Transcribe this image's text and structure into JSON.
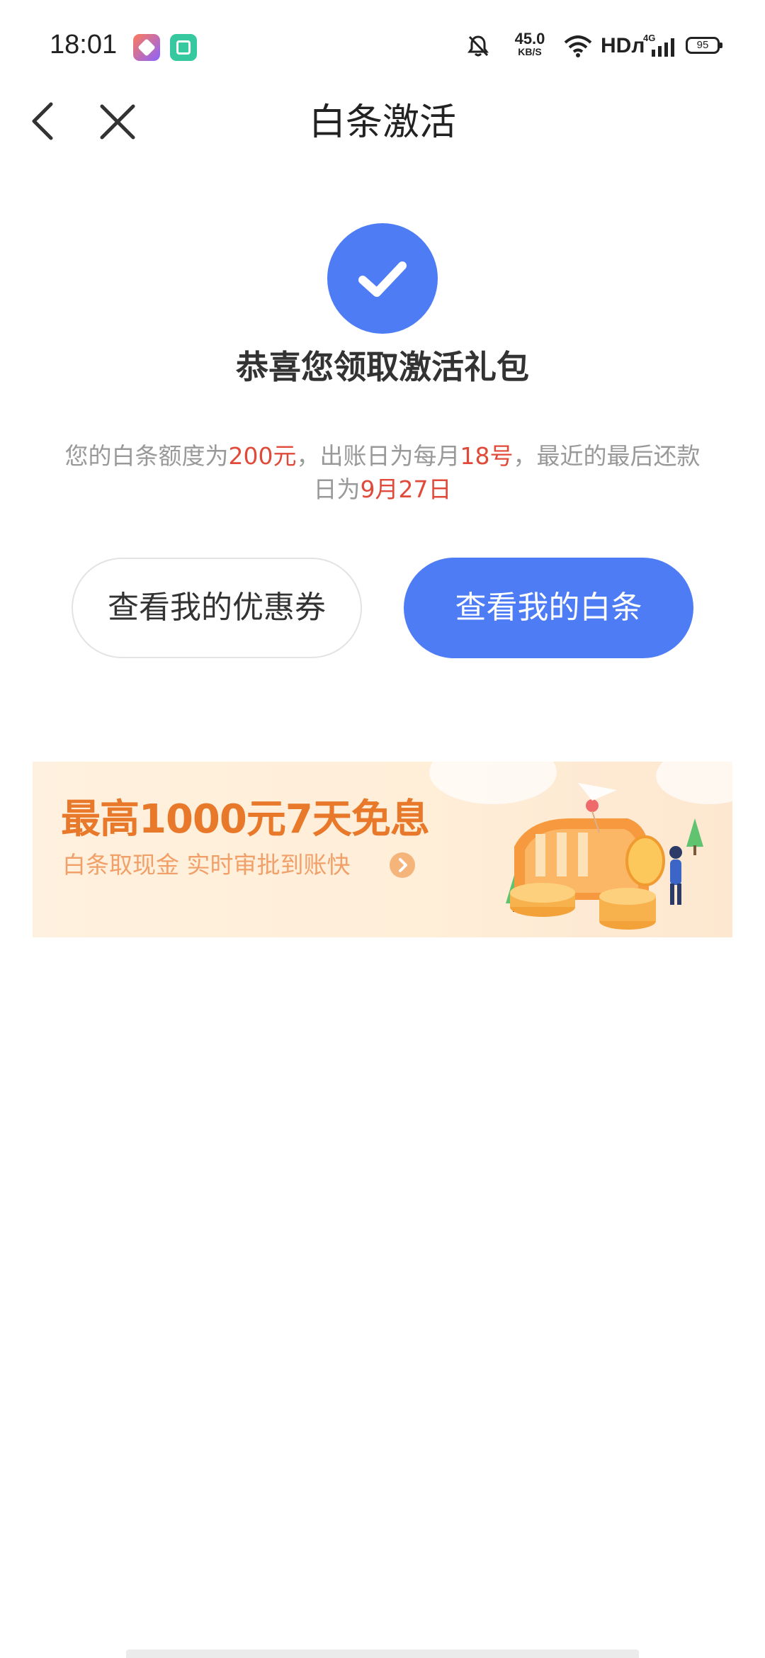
{
  "status_bar": {
    "time": "18:01",
    "net_speed": "45.0",
    "net_speed_unit": "KB/S",
    "hd": "HDл",
    "network": "4G",
    "battery": "95"
  },
  "nav": {
    "title": "白条激活",
    "back_icon": "chevron-left-icon",
    "close_icon": "close-icon"
  },
  "success": {
    "icon": "check-circle-icon",
    "title": "恭喜您领取激活礼包"
  },
  "description": {
    "p1": "您的白条额度为",
    "limit": "200元",
    "p2": "，出账日为每月",
    "bill_day": "18号",
    "p3": "，最近的最后还款日为",
    "due_date": "9月27日"
  },
  "buttons": {
    "coupon": "查看我的优惠券",
    "baitiao": "查看我的白条"
  },
  "banner": {
    "title": "最高1000元7天免息",
    "subtitle": "白条取现金 实时审批到账快"
  },
  "colors": {
    "primary": "#4d7cf5",
    "highlight": "#e04a3a",
    "banner_text": "#e8792a"
  }
}
